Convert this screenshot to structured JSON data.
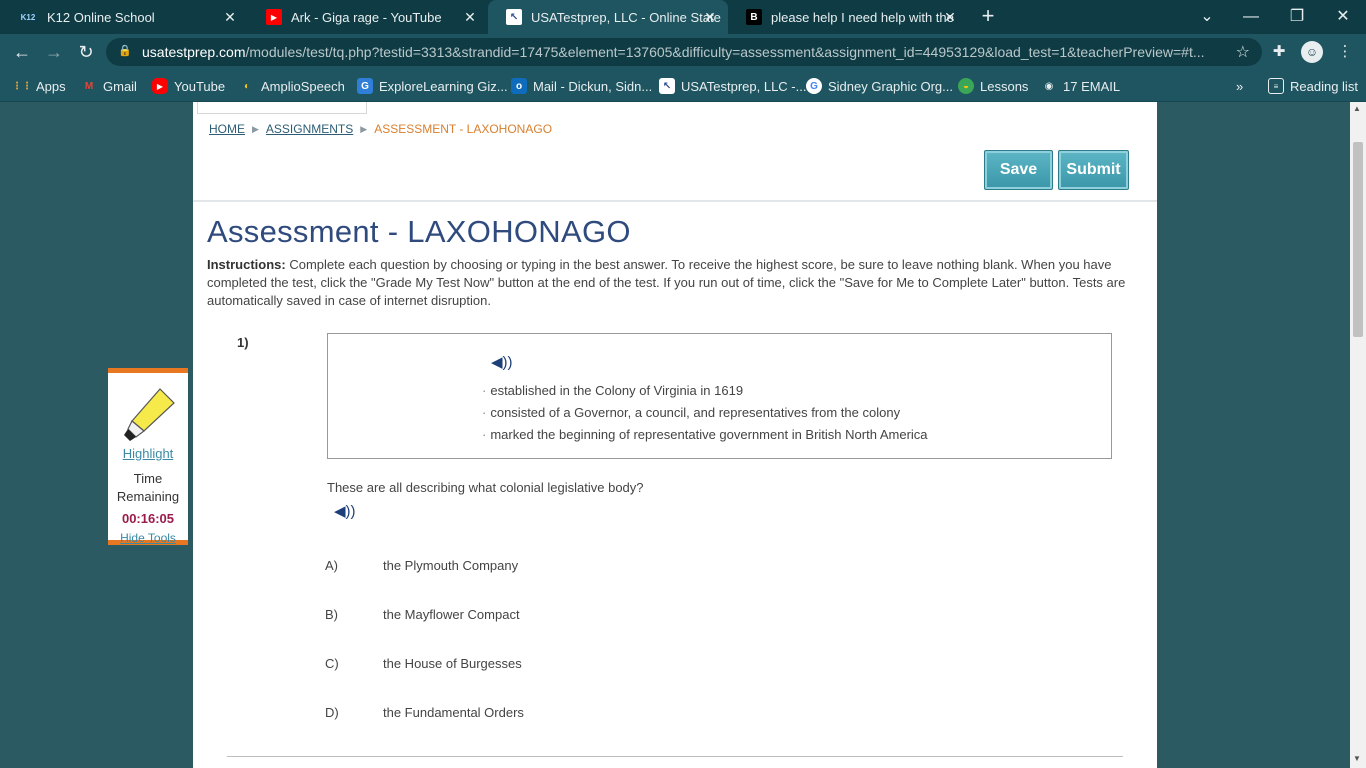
{
  "browser": {
    "tabs": [
      {
        "icon_text": "K12",
        "title": "K12 Online School",
        "icon_bg": "#0f3c44",
        "icon_color": "#9fd3ff"
      },
      {
        "icon_text": "▶",
        "title": "Ark - Giga rage - YouTube",
        "icon_bg": "#ff0000",
        "icon_color": "#ffffff"
      },
      {
        "icon_text": "↖",
        "title": "USATestprep, LLC - Online State-",
        "icon_bg": "#ffffff",
        "icon_color": "#2b4c8a"
      },
      {
        "icon_text": "B",
        "title": "please help I need help with the",
        "icon_bg": "#000000",
        "icon_color": "#ffffff"
      }
    ],
    "url_host": "usatestprep.com",
    "url_path": "/modules/test/tq.php?testid=3313&strandid=17475&element=137605&difficulty=assessment&assignment_id=44953129&load_test=1&teacherPreview=#t...",
    "bookmarks": [
      {
        "icon_text": "⋮⋮",
        "label": "Apps",
        "icon_bg": "transparent",
        "icon_color": "#e8a53a"
      },
      {
        "icon_text": "M",
        "label": "Gmail",
        "icon_bg": "transparent",
        "icon_color": "#ea4335"
      },
      {
        "icon_text": "▶",
        "label": "YouTube",
        "icon_bg": "#ff0000",
        "icon_color": "#ffffff"
      },
      {
        "icon_text": "◐",
        "label": "AmplioSpeech",
        "icon_bg": "transparent",
        "icon_color": "#f3c316"
      },
      {
        "icon_text": "G",
        "label": "ExploreLearning Giz...",
        "icon_bg": "#2f7fd8",
        "icon_color": "#ffffff"
      },
      {
        "icon_text": "o",
        "label": "Mail - Dickun, Sidn...",
        "icon_bg": "#0f6cbd",
        "icon_color": "#ffffff"
      },
      {
        "icon_text": "↖",
        "label": "USATestprep, LLC -...",
        "icon_bg": "#ffffff",
        "icon_color": "#2b4c8a"
      },
      {
        "icon_text": "G",
        "label": "Sidney Graphic Org...",
        "icon_bg": "#ffffff",
        "icon_color": "#4285f4"
      },
      {
        "icon_text": "◒",
        "label": "Lessons",
        "icon_bg": "#3aa657",
        "icon_color": "#f3c316"
      },
      {
        "icon_text": "◉",
        "label": "17 EMAIL",
        "icon_bg": "transparent",
        "icon_color": "#e8eef0"
      }
    ],
    "more_label": "»",
    "reading_list": "Reading list"
  },
  "page": {
    "breadcrumb": {
      "home": "HOME",
      "assignments": "ASSIGNMENTS",
      "current": "ASSESSMENT - LAXOHONAGO"
    },
    "save_label": "Save",
    "submit_label": "Submit",
    "title": "Assessment - LAXOHONAGO",
    "instructions_label": "Instructions:",
    "instructions_text": " Complete each question by choosing or typing in the best answer. To receive the highest score, be sure to leave nothing blank. When you have completed the test, click the \"Grade My Test Now\" button at the end of the test. If you run out of time, click the \"Save for Me to Complete Later\" button. Tests are automatically saved in case of internet disruption.",
    "question": {
      "number": "1)",
      "bullets": [
        "established in the Colony of Virginia in 1619",
        "consisted of a Governor, a council, and representatives from the colony",
        "marked the beginning of representative government in British North America"
      ],
      "prompt": "These are all describing what colonial legislative body?",
      "choices": [
        {
          "letter": "A)",
          "text": "the Plymouth Company"
        },
        {
          "letter": "B)",
          "text": "the Mayflower Compact"
        },
        {
          "letter": "C)",
          "text": "the House of Burgesses"
        },
        {
          "letter": "D)",
          "text": "the Fundamental Orders"
        }
      ]
    }
  },
  "tools": {
    "highlight": "Highlight",
    "time_remaining": "Time Remaining",
    "timer": "00:16:05",
    "hide_tools": "Hide Tools"
  }
}
